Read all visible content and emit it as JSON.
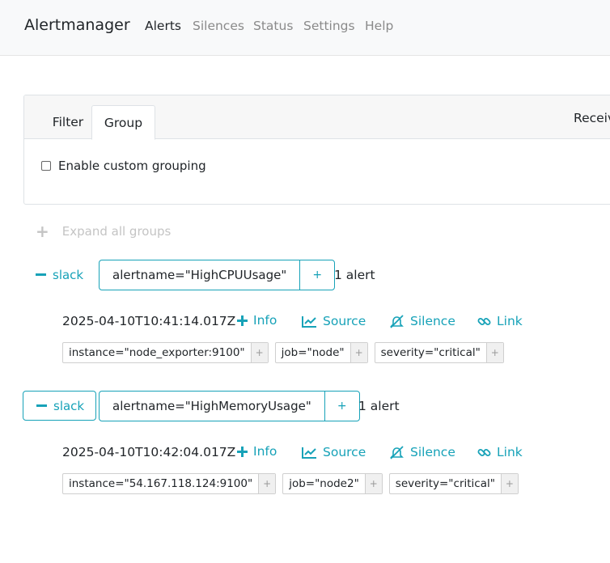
{
  "navbar": {
    "brand": "Alertmanager",
    "links": [
      "Alerts",
      "Silences",
      "Status",
      "Settings",
      "Help"
    ]
  },
  "filter_card": {
    "tabs": [
      "Filter",
      "Group"
    ],
    "receiver_label": "Receiv",
    "custom_grouping_label": "Enable custom grouping"
  },
  "expand_all_label": "Expand all groups",
  "groups": [
    {
      "receiver": "slack",
      "label": "alertname=\"HighCPUUsage\"",
      "plus": "+",
      "count": "1 alert",
      "alert": {
        "timestamp": "2025-04-10T10:41:14.017Z",
        "actions": [
          "Info",
          "Source",
          "Silence",
          "Link"
        ],
        "labels": [
          "instance=\"node_exporter:9100\"",
          "job=\"node\"",
          "severity=\"critical\""
        ]
      }
    },
    {
      "receiver": "slack",
      "label": "alertname=\"HighMemoryUsage\"",
      "plus": "+",
      "count": "1 alert",
      "alert": {
        "timestamp": "2025-04-10T10:42:04.017Z",
        "actions": [
          "Info",
          "Source",
          "Silence",
          "Link"
        ],
        "labels": [
          "instance=\"54.167.118.124:9100\"",
          "job=\"node2\"",
          "severity=\"critical\""
        ]
      }
    }
  ],
  "chip_plus": "+",
  "colors": {
    "accent": "#17a2b8",
    "muted": "#8a8a8a",
    "navbar_bg": "#f8f9fa"
  }
}
